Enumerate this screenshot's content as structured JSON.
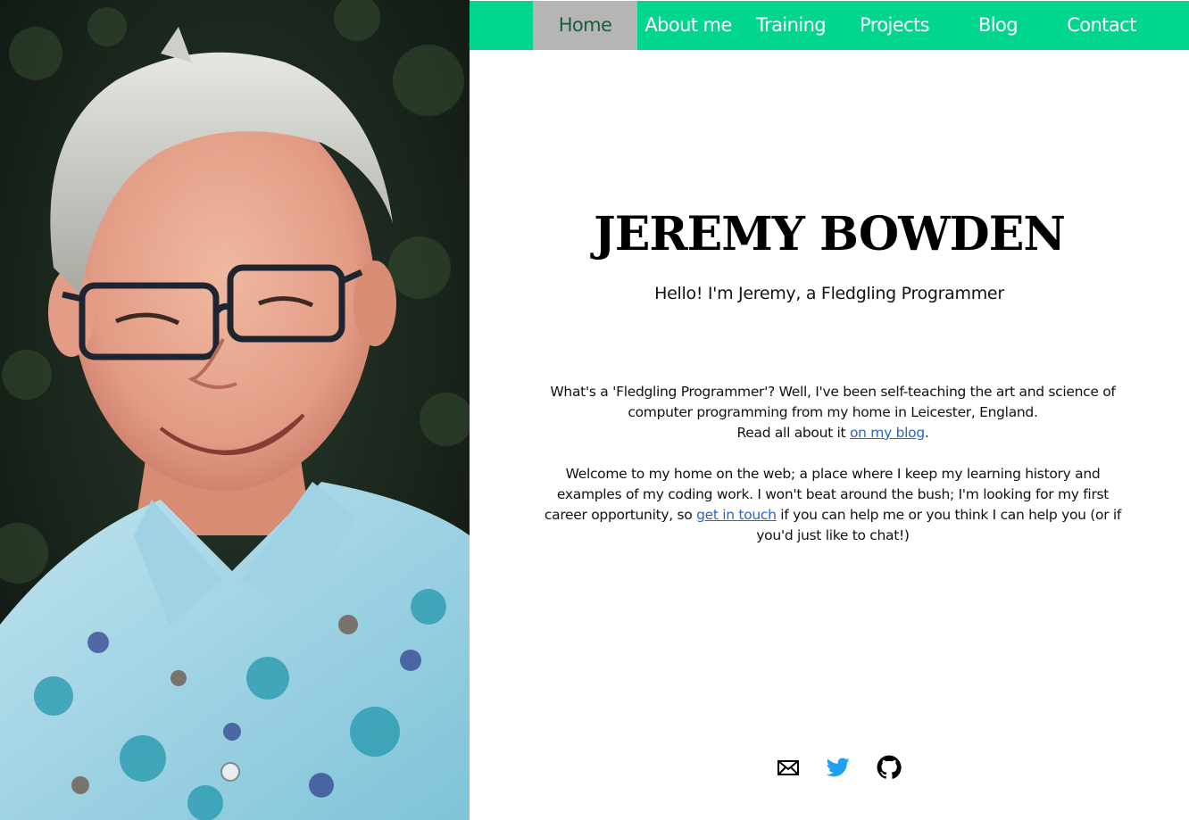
{
  "nav": {
    "items": [
      {
        "label": "Home",
        "active": true
      },
      {
        "label": "About me",
        "active": false
      },
      {
        "label": "Training",
        "active": false
      },
      {
        "label": "Projects",
        "active": false
      },
      {
        "label": "Blog",
        "active": false
      },
      {
        "label": "Contact",
        "active": false
      }
    ],
    "colors": {
      "bar": "#00d68f",
      "active_bg": "#b5b5b5",
      "active_text": "#1c5c3a",
      "text": "#ffffff"
    }
  },
  "hero": {
    "title": "JEREMY BOWDEN",
    "tagline": "Hello! I'm Jeremy, a Fledgling Programmer"
  },
  "intro": {
    "p1_text": "What's a 'Fledgling Programmer'? Well, I've been self-teaching the art and science of computer programming from my home in Leicester, England.",
    "p1_line3_text": "Read all about it ",
    "p1_link": "on my blog",
    "p1_end": ".",
    "p2_text": "Welcome to my home on the web; a place where I keep my learning history and examples of my coding work. I won't beat around the bush; I'm looking for my first career opportunity, so ",
    "p2_link": "get in touch",
    "p2_end": " if you can help me or you think I can help you (or if you'd just like to chat!)",
    "link_color": "#2a64c4"
  },
  "social": {
    "icons": [
      "email-icon",
      "twitter-icon",
      "github-icon"
    ],
    "twitter_color": "#1da1f2"
  }
}
